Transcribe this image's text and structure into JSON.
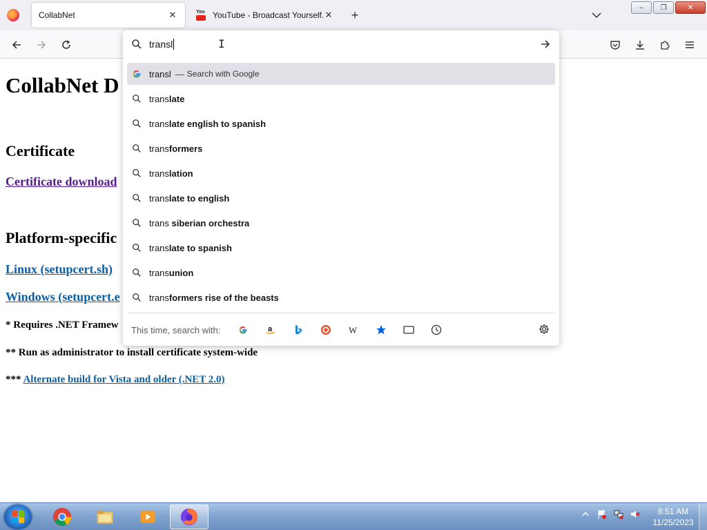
{
  "browser": {
    "tabs": [
      {
        "title": "CollabNet",
        "active": true
      },
      {
        "title": "YouTube - Broadcast Yourself.",
        "active": false
      }
    ],
    "close_glyph": "✕",
    "newtab_glyph": "+",
    "window_controls": {
      "minimize": "–",
      "maximize": "❐",
      "close": "✕"
    }
  },
  "urlbar": {
    "typed_text": "transl",
    "selected_suggestion": {
      "typed": "transl",
      "separator": "—",
      "hint": "Search with Google"
    },
    "suggestions": [
      {
        "typed": "trans",
        "bold": "late"
      },
      {
        "typed": "trans",
        "bold": "late english to spanish"
      },
      {
        "typed": "trans",
        "bold": "formers"
      },
      {
        "typed": "trans",
        "bold": "lation"
      },
      {
        "typed": "trans",
        "bold": "late to english"
      },
      {
        "typed": "trans",
        "bold": " siberian orchestra"
      },
      {
        "typed": "trans",
        "bold": "late to spanish"
      },
      {
        "typed": "trans",
        "bold": "union"
      },
      {
        "typed": "trans",
        "bold": "formers rise of the beasts"
      }
    ],
    "one_off_label": "This time, search with:",
    "engines": [
      "google-icon",
      "amazon-icon",
      "bing-icon",
      "duckduckgo-icon",
      "wikipedia-icon",
      "bookmarks-icon",
      "tabs-icon",
      "history-icon"
    ]
  },
  "page": {
    "heading": "CollabNet D",
    "section_certificate": "Certificate",
    "certificate_link": "Certificate download",
    "section_platform": "Platform-specific",
    "linux_link": "Linux (setupcert.sh)",
    "windows_link": "Windows (setupcert.e",
    "note1": "* Requires .NET Framew",
    "note2": "** Run as administrator to install certificate system-wide",
    "note3_prefix": "*** ",
    "note3_link": "Alternate build for Vista and older (.NET 2.0)"
  },
  "taskbar": {
    "time": "8:51 AM",
    "date": "11/25/2023"
  },
  "colors": {
    "visited_link": "#551a8b",
    "link": "#0b5fa5",
    "selected_row": "#e0e0e6"
  }
}
